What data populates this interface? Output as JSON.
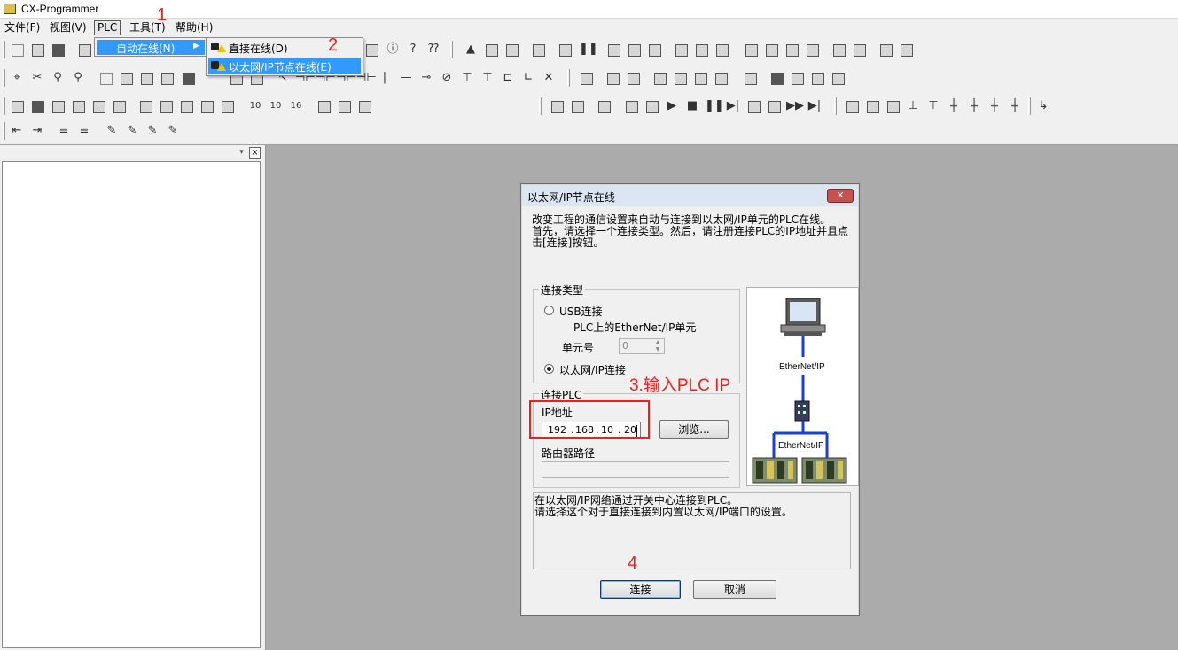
{
  "window": {
    "title": "CX-Programmer"
  },
  "menubar": {
    "file": "文件(F)",
    "view": "视图(V)",
    "plc": "PLC",
    "tools": "工具(T)",
    "help": "帮助(H)"
  },
  "plc_menu": {
    "auto_online": "自动在线(N)"
  },
  "auto_online_submenu": {
    "direct_online": "直接在线(D)",
    "ethernet_ip_online": "以太网/IP节点在线(E)"
  },
  "annotations": {
    "step1": "1",
    "step2": "2",
    "step3": "3.输入PLC IP",
    "step4": "4"
  },
  "dialog": {
    "title": "以太网/IP节点在线",
    "description": [
      "改变工程的通信设置来自动与连接到以太网/IP单元的PLC在线。",
      "首先，请选择一个连接类型。然后，请注册连接PLC的IP地址并且点",
      "击[连接]按钮。"
    ],
    "connection_type": {
      "label": "连接类型",
      "usb_option": "USB连接",
      "ethernetip_unit_on_plc": "PLC上的EtherNet/IP单元",
      "unit_number_label": "单元号",
      "unit_number_value": "0",
      "ethernet_ip_option": "以太网/IP连接"
    },
    "connect_plc": {
      "label": "连接PLC",
      "ip_label": "IP地址",
      "ip": [
        "192",
        "168",
        "10",
        "20"
      ],
      "browse_button": "浏览...",
      "router_path_label": "路由器路径"
    },
    "diagram": {
      "label_top": "EtherNet/IP",
      "label_bottom": "EtherNet/IP"
    },
    "info_text": [
      "在以太网/IP网络通过开关中心连接到PLC。",
      "请选择这个对于直接连接到内置以太网/IP端口的设置。"
    ],
    "connect_button": "连接",
    "cancel_button": "取消"
  },
  "colors": {
    "annotation_red": "#e8231a",
    "menu_highlight": "#3399ff",
    "workspace_gray": "#ababab",
    "network_line": "#1d3fd8",
    "close_button": "#c75050"
  }
}
